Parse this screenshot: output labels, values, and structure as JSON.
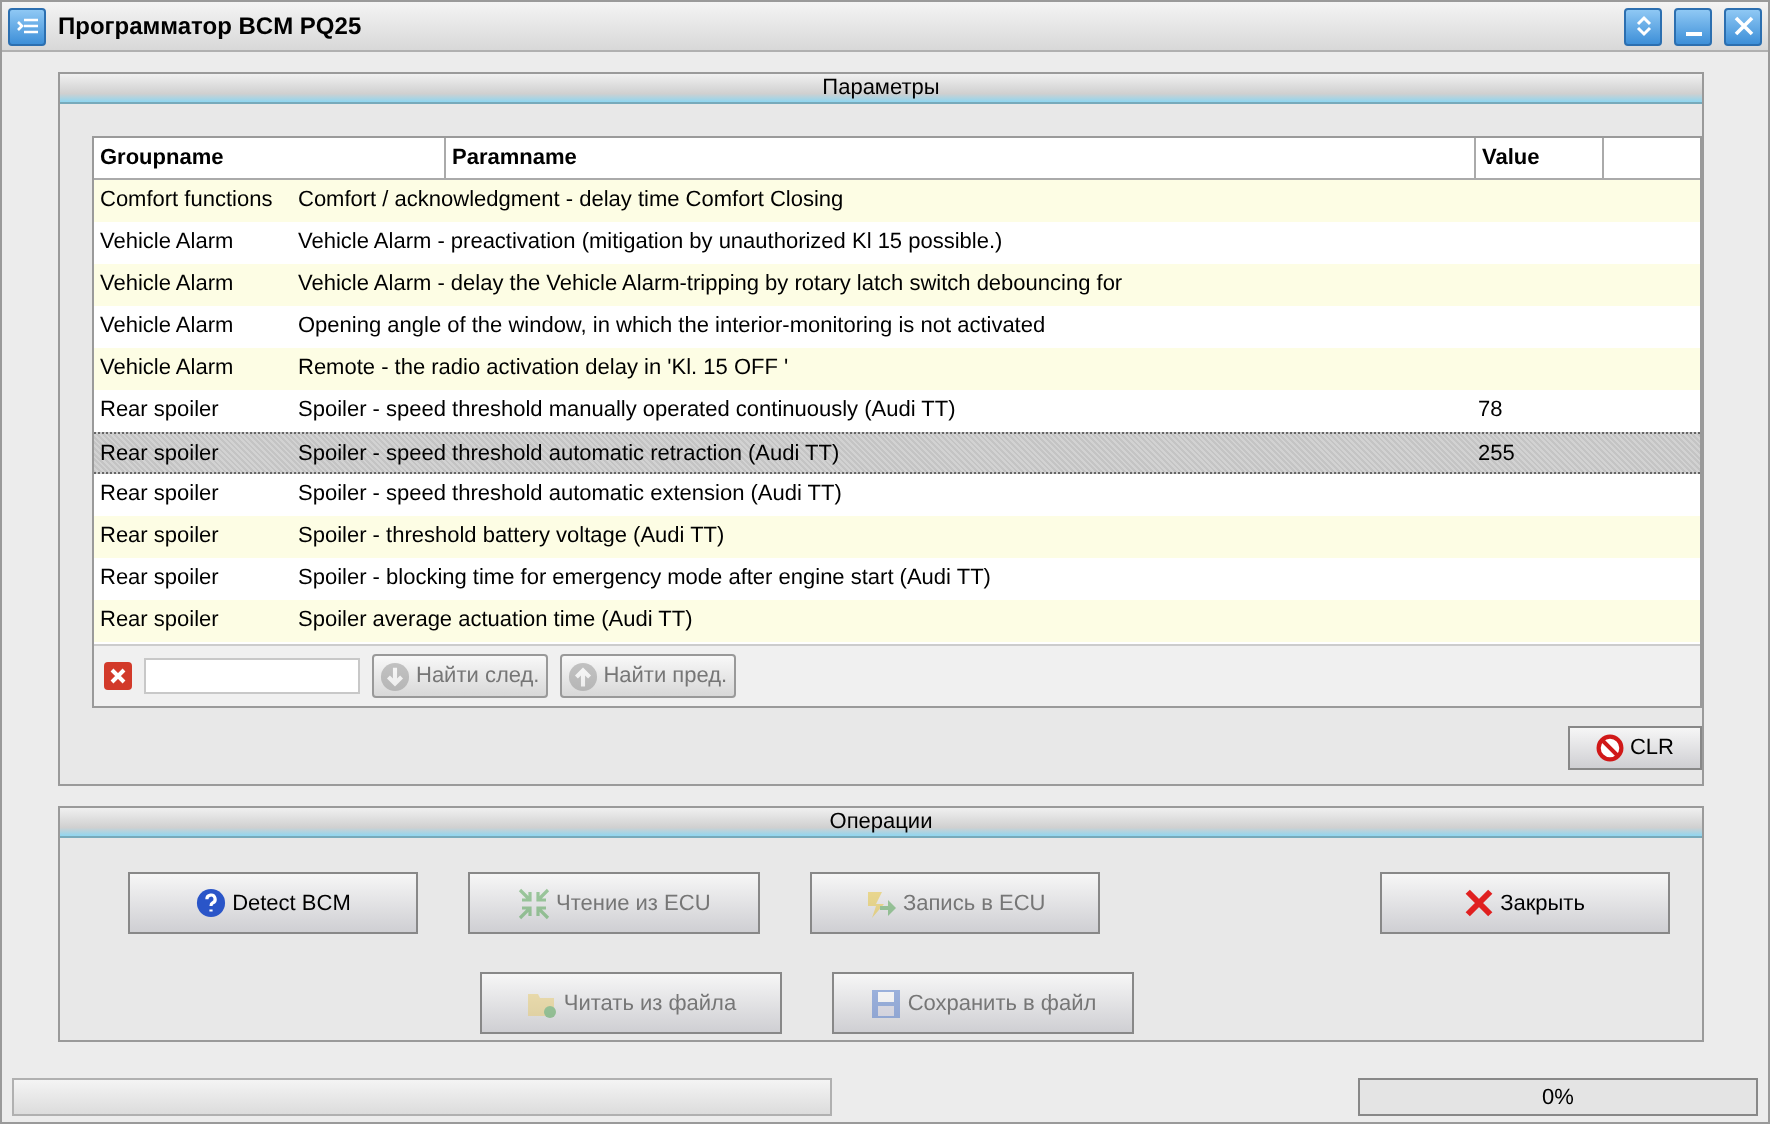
{
  "window": {
    "title": "Программатор BCM PQ25"
  },
  "parameters": {
    "title": "Параметры",
    "table": {
      "columns": [
        "Groupname",
        "Paramname",
        "Value"
      ],
      "rows": [
        {
          "group": "Comfort functions",
          "param": "Comfort / acknowledgment - delay time Comfort Closing",
          "value": "",
          "selected": false
        },
        {
          "group": "Vehicle Alarm",
          "param": "Vehicle Alarm - preactivation (mitigation by unauthorized Kl 15 possible.)",
          "value": "",
          "selected": false
        },
        {
          "group": "Vehicle Alarm",
          "param": "Vehicle Alarm - delay the Vehicle Alarm-tripping by rotary latch switch debouncing for",
          "value": "",
          "selected": false
        },
        {
          "group": "Vehicle Alarm",
          "param": "Opening angle of  the window, in which the interior-monitoring is not activated",
          "value": "",
          "selected": false
        },
        {
          "group": "Vehicle Alarm",
          "param": "Remote - the radio activation delay in 'Kl. 15 OFF '",
          "value": "",
          "selected": false
        },
        {
          "group": "Rear spoiler",
          "param": "Spoiler - speed threshold manually operated continuously (Audi TT)",
          "value": "78",
          "selected": false
        },
        {
          "group": "Rear spoiler",
          "param": "Spoiler - speed threshold automatic retraction (Audi TT)",
          "value": "255",
          "selected": true
        },
        {
          "group": "Rear spoiler",
          "param": "Spoiler - speed threshold automatic extension (Audi TT)",
          "value": "",
          "selected": false
        },
        {
          "group": "Rear spoiler",
          "param": "Spoiler - threshold battery voltage (Audi TT)",
          "value": "",
          "selected": false
        },
        {
          "group": "Rear spoiler",
          "param": "Spoiler - blocking time for emergency mode after engine start (Audi TT)",
          "value": "",
          "selected": false
        },
        {
          "group": "Rear spoiler",
          "param": "Spoiler average actuation time (Audi TT)",
          "value": "",
          "selected": false
        }
      ]
    },
    "search": {
      "find_next": {
        "label": "Найти след.",
        "disabled": true
      },
      "find_prev": {
        "label": "Найти пред.",
        "disabled": true
      }
    },
    "clear_button": "CLR"
  },
  "operations": {
    "title": "Операции",
    "rows": [
      [
        {
          "kind": "detect",
          "label": "Detect BCM",
          "disabled": false
        },
        {
          "kind": "read",
          "label": "Чтение из ECU",
          "disabled": true
        },
        {
          "kind": "write",
          "label": "Запись в ECU",
          "disabled": true
        },
        {
          "kind": "gap"
        },
        {
          "kind": "close",
          "label": "Закрыть",
          "disabled": false
        }
      ],
      [
        {
          "kind": "gap"
        },
        {
          "kind": "load",
          "label": "Читать из файла",
          "disabled": true
        },
        {
          "kind": "save",
          "label": "Сохранить в файл",
          "disabled": true
        }
      ]
    ]
  },
  "status_bar": {
    "progress": "0%"
  }
}
